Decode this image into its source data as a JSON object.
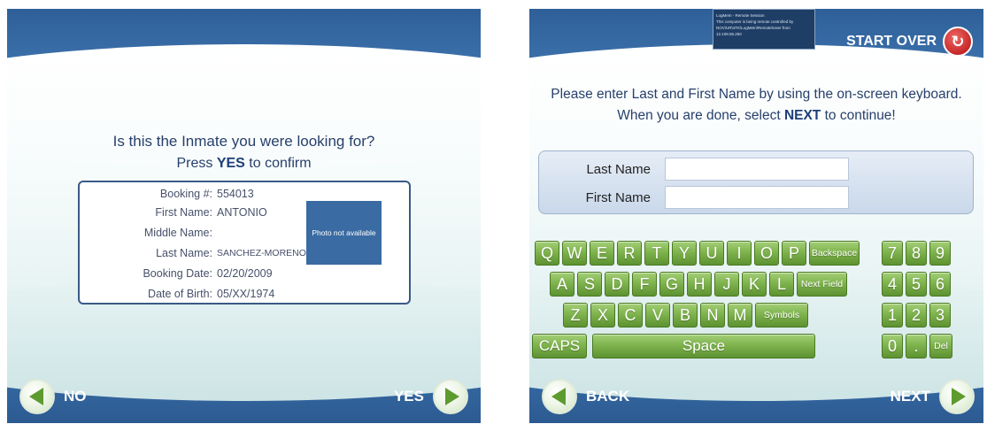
{
  "left_screen": {
    "question": "Is this the Inmate you were looking for?",
    "press_prefix": "Press",
    "confirm_word": "YES",
    "press_suffix": "to confirm",
    "fields": [
      {
        "label": "Booking #:",
        "value": "554013"
      },
      {
        "label": "First Name:",
        "value": "ANTONIO"
      },
      {
        "label": "Middle Name:",
        "value": ""
      },
      {
        "label": "Last Name:",
        "value": "SANCHEZ-MORENO"
      },
      {
        "label": "Booking Date:",
        "value": "02/20/2009"
      },
      {
        "label": "Date of Birth:",
        "value": "05/XX/1974"
      }
    ],
    "photo_text": "Photo not available",
    "no_label": "NO",
    "yes_label": "YES"
  },
  "right_screen": {
    "tooltip_title": "LogMeIn - Remote Session",
    "tooltip_body": "This computer is being remote controlled by NOV\\UR\\4TK\\LogMeIn\\Remote\\User from 12.108.55.250",
    "start_over_label": "START OVER",
    "instruction_line1": "Please enter Last and First Name by using the on-screen keyboard.",
    "instruction_line2_prefix": "When you are done, select",
    "instruction_next_word": "NEXT",
    "instruction_line2_suffix": "to continue!",
    "last_name_label": "Last Name",
    "last_name_value": "",
    "first_name_label": "First Name",
    "first_name_value": "",
    "keyboard": {
      "row1": [
        "Q",
        "W",
        "E",
        "R",
        "T",
        "Y",
        "U",
        "I",
        "O",
        "P"
      ],
      "backspace": "Backspace",
      "row2": [
        "A",
        "S",
        "D",
        "F",
        "G",
        "H",
        "J",
        "K",
        "L"
      ],
      "next_field": "Next Field",
      "row3": [
        "Z",
        "X",
        "C",
        "V",
        "B",
        "N",
        "M"
      ],
      "symbols": "Symbols",
      "caps": "CAPS",
      "space": "Space",
      "numpad": [
        "7",
        "8",
        "9",
        "4",
        "5",
        "6",
        "1",
        "2",
        "3",
        "0",
        ".",
        "Del"
      ]
    },
    "back_label": "BACK",
    "next_label": "NEXT"
  },
  "colors": {
    "header_blue": "#2f5f98",
    "key_green": "#7fb34d",
    "start_over_red": "#c62828",
    "prompt_text": "#27406b"
  }
}
